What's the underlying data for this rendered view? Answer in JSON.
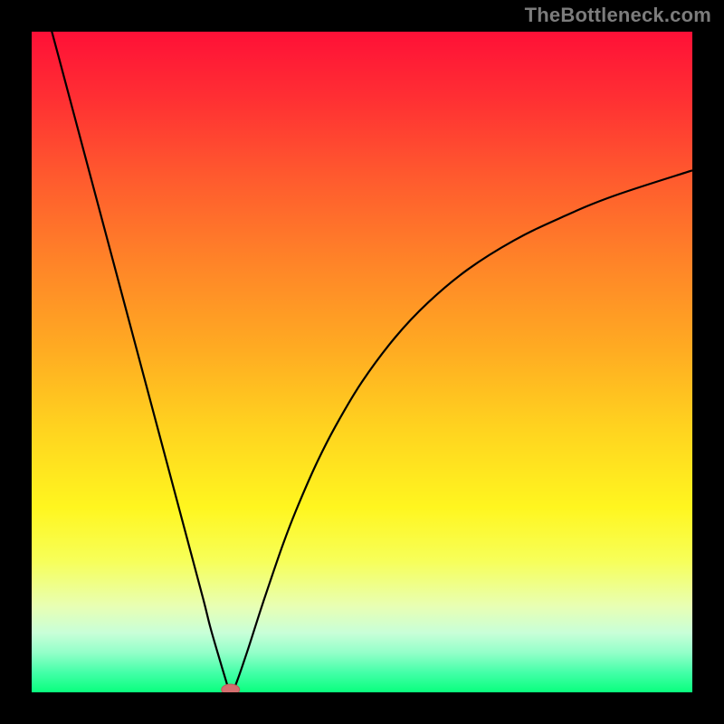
{
  "watermark": "TheBottleneck.com",
  "colors": {
    "frame": "#000000",
    "curve": "#000000",
    "min_point_fill": "#d46e6e",
    "min_point_stroke": "#bb5a5a",
    "watermark": "#7c7c7c"
  },
  "chart_data": {
    "type": "line",
    "title": "",
    "xlabel": "",
    "ylabel": "",
    "xlim": [
      0,
      100
    ],
    "ylim": [
      0,
      100
    ],
    "grid": false,
    "legend": false,
    "annotations": [
      "TheBottleneck.com"
    ],
    "minimum": {
      "x": 30.1,
      "y": 0
    },
    "series": [
      {
        "name": "bottleneck-curve",
        "x": [
          0,
          2,
          4,
          6,
          8,
          10,
          12,
          14,
          16,
          18,
          20,
          22,
          24,
          26,
          27,
          28,
          28.8,
          29.4,
          29.8,
          30.1,
          30.6,
          31.2,
          32,
          33,
          34.5,
          36,
          38,
          40,
          43,
          46,
          50,
          55,
          60,
          66,
          73,
          80,
          88,
          100
        ],
        "y": [
          112,
          104,
          96.5,
          89,
          81.5,
          74,
          66.5,
          59,
          51.5,
          44,
          36.5,
          29,
          21.5,
          14,
          10,
          6.5,
          3.8,
          1.8,
          0.5,
          0,
          0.5,
          2,
          4.3,
          7.3,
          12,
          16.5,
          22.3,
          27.5,
          34.4,
          40.3,
          47,
          53.7,
          59,
          64,
          68.4,
          71.8,
          75.1,
          79
        ]
      }
    ]
  }
}
